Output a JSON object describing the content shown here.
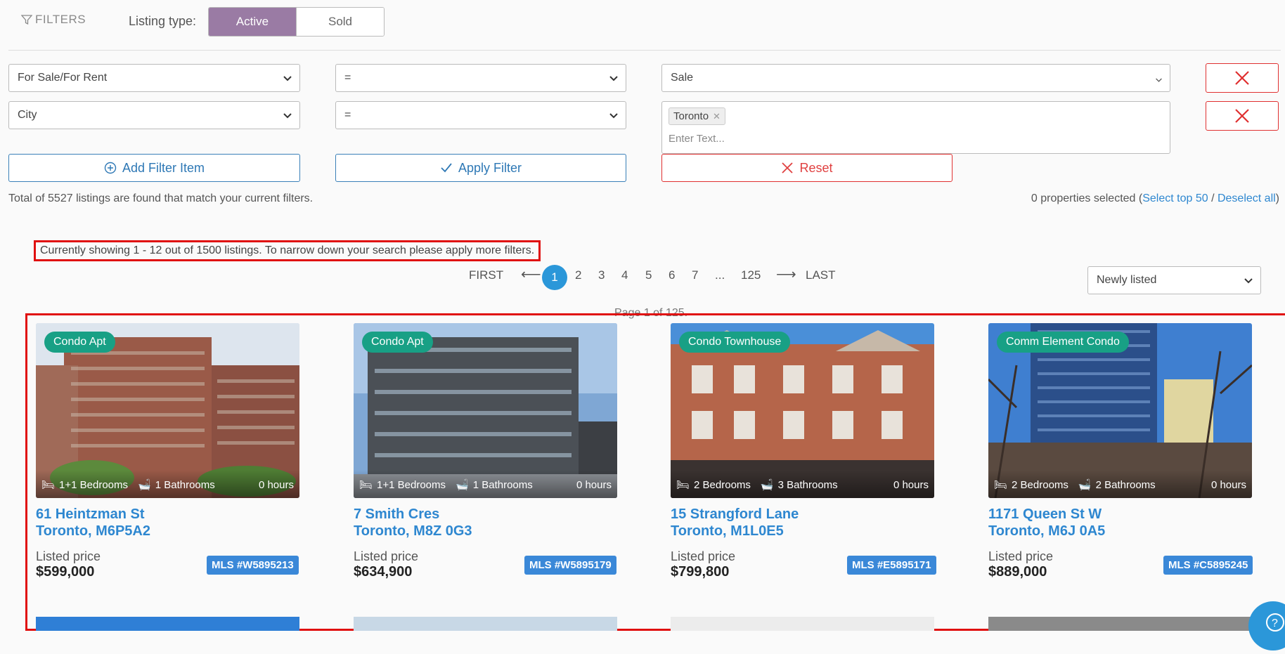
{
  "filters": {
    "label": "FILTERS",
    "listing_type_label": "Listing type:",
    "listing_types": [
      "Active",
      "Sold"
    ],
    "active_type": "Active",
    "rows": [
      {
        "field": "For Sale/For Rent",
        "operator": "=",
        "value": "Sale"
      },
      {
        "field": "City",
        "operator": "=",
        "chips": [
          "Toronto"
        ],
        "placeholder": "Enter Text..."
      }
    ],
    "add_filter_label": "Add Filter Item",
    "apply_filter_label": "Apply Filter",
    "reset_label": "Reset"
  },
  "results": {
    "total_text": "Total of 5527 listings are found that match your current filters.",
    "selected_text": "0 properties selected",
    "select_top_label": "Select top 50",
    "deselect_label": "Deselect all",
    "notice": "Currently showing 1 - 12 out of 1500 listings. To narrow down your search please apply more filters."
  },
  "pagination": {
    "first": "FIRST",
    "last": "LAST",
    "pages": [
      "1",
      "2",
      "3",
      "4",
      "5",
      "6",
      "7",
      "...",
      "125"
    ],
    "current": "1",
    "page_of": "Page 1 of 125.",
    "sort_value": "Newly listed"
  },
  "listings": [
    {
      "type": "Condo Apt",
      "bedrooms": "1+1 Bedrooms",
      "bathrooms": "1 Bathrooms",
      "age": "0 hours",
      "street": "61 Heintzman St",
      "city": "Toronto, M6P5A2",
      "price_label": "Listed price",
      "price": "$599,000",
      "mls": "MLS #W5895213"
    },
    {
      "type": "Condo Apt",
      "bedrooms": "1+1 Bedrooms",
      "bathrooms": "1 Bathrooms",
      "age": "0 hours",
      "street": "7 Smith Cres",
      "city": "Toronto, M8Z 0G3",
      "price_label": "Listed price",
      "price": "$634,900",
      "mls": "MLS #W5895179"
    },
    {
      "type": "Condo Townhouse",
      "bedrooms": "2 Bedrooms",
      "bathrooms": "3 Bathrooms",
      "age": "0 hours",
      "street": "15 Strangford Lane",
      "city": "Toronto, M1L0E5",
      "price_label": "Listed price",
      "price": "$799,800",
      "mls": "MLS #E5895171"
    },
    {
      "type": "Comm Element Condo",
      "bedrooms": "2 Bedrooms",
      "bathrooms": "2 Bathrooms",
      "age": "0 hours",
      "street": "1171 Queen St W",
      "city": "Toronto, M6J 0A5",
      "price_label": "Listed price",
      "price": "$889,000",
      "mls": "MLS #C5895245"
    }
  ],
  "colors": {
    "accent": "#9a7ba4",
    "link": "#2e87d0",
    "badge": "#18a085",
    "mls": "#3a88d8",
    "highlight": "#e01010"
  }
}
